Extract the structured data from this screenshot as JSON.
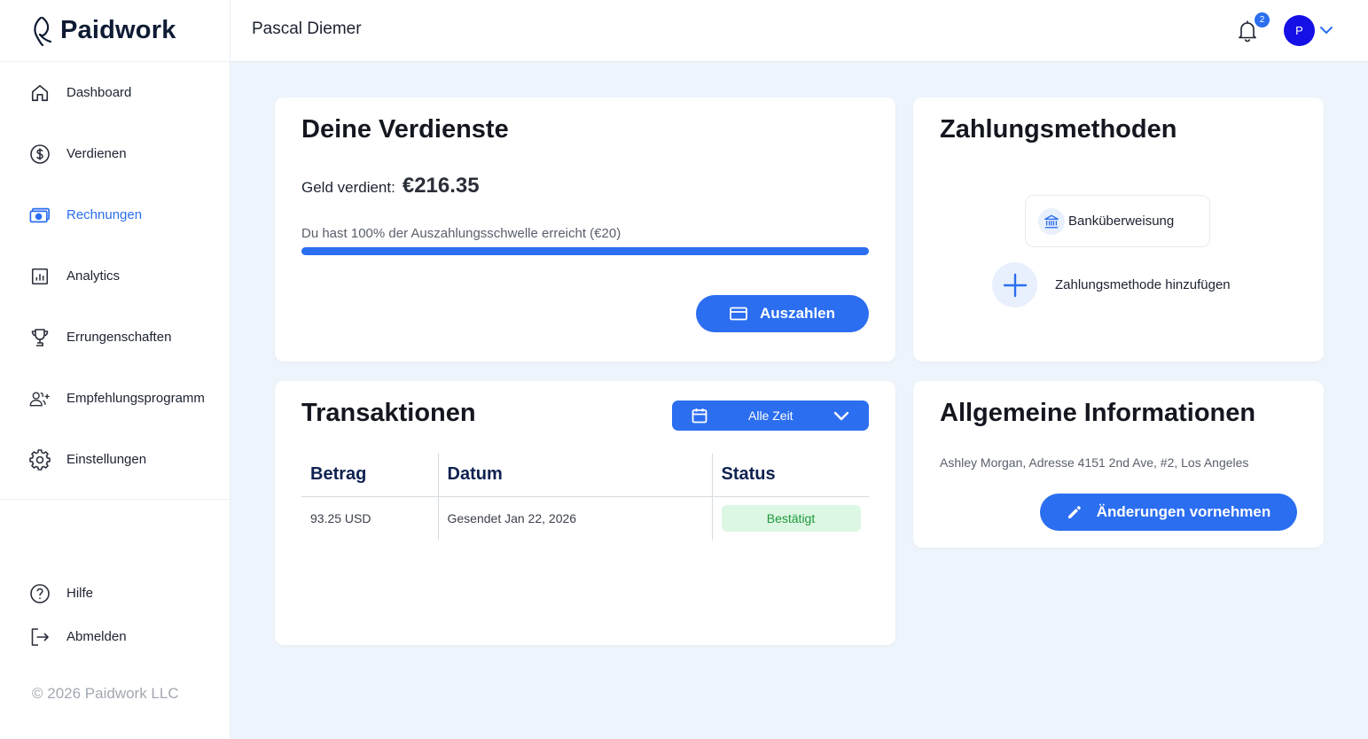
{
  "brand": {
    "name": "Paidwork"
  },
  "sidebar": {
    "items": [
      {
        "label": "Dashboard",
        "icon": "home-icon"
      },
      {
        "label": "Verdienen",
        "icon": "dollar-icon"
      },
      {
        "label": "Rechnungen",
        "icon": "money-icon",
        "active": true
      },
      {
        "label": "Analytics",
        "icon": "chart-icon"
      },
      {
        "label": "Errungenschaften",
        "icon": "trophy-icon"
      },
      {
        "label": "Empfehlungsprogramm",
        "icon": "user-add-icon"
      },
      {
        "label": "Einstellungen",
        "icon": "gear-icon"
      }
    ],
    "bottom_items": [
      {
        "label": "Hilfe",
        "icon": "help-icon"
      },
      {
        "label": "Abmelden",
        "icon": "logout-icon"
      }
    ],
    "copyright": "© 2026 Paidwork LLC"
  },
  "header": {
    "username": "Pascal Diemer",
    "notification_count": "2",
    "avatar_initial": "P"
  },
  "earnings": {
    "title": "Deine Verdienste",
    "earned_label": "Geld verdient:",
    "earned_value": "€216.35",
    "threshold_text": "Du hast 100% der Auszahlungsschwelle erreicht (€20)",
    "progress_fraction": 1.0,
    "payout_label": "Auszahlen"
  },
  "payment_methods": {
    "title": "Zahlungsmethoden",
    "bank_label": "Banküberweisung",
    "add_label": "Zahlungsmethode hinzufügen"
  },
  "transactions": {
    "title": "Transaktionen",
    "period": "Alle Zeit",
    "columns": [
      "Betrag",
      "Datum",
      "Status"
    ],
    "rows": [
      {
        "amount": "93.25 USD",
        "date": "Gesendet Jan 22, 2026",
        "status": "Bestätigt"
      }
    ]
  },
  "info": {
    "title": "Allgemeine Informationen",
    "address": "Ashley Morgan, Adresse 4151 2nd Ave, #2, Los Angeles",
    "edit_label": "Änderungen vornehmen"
  },
  "colors": {
    "accent": "#2b6ef0",
    "avatar": "#1510e6",
    "status_success_bg": "#dcf7e3",
    "status_success_text": "#1e9a3a",
    "page_bg": "#eef4fb"
  }
}
